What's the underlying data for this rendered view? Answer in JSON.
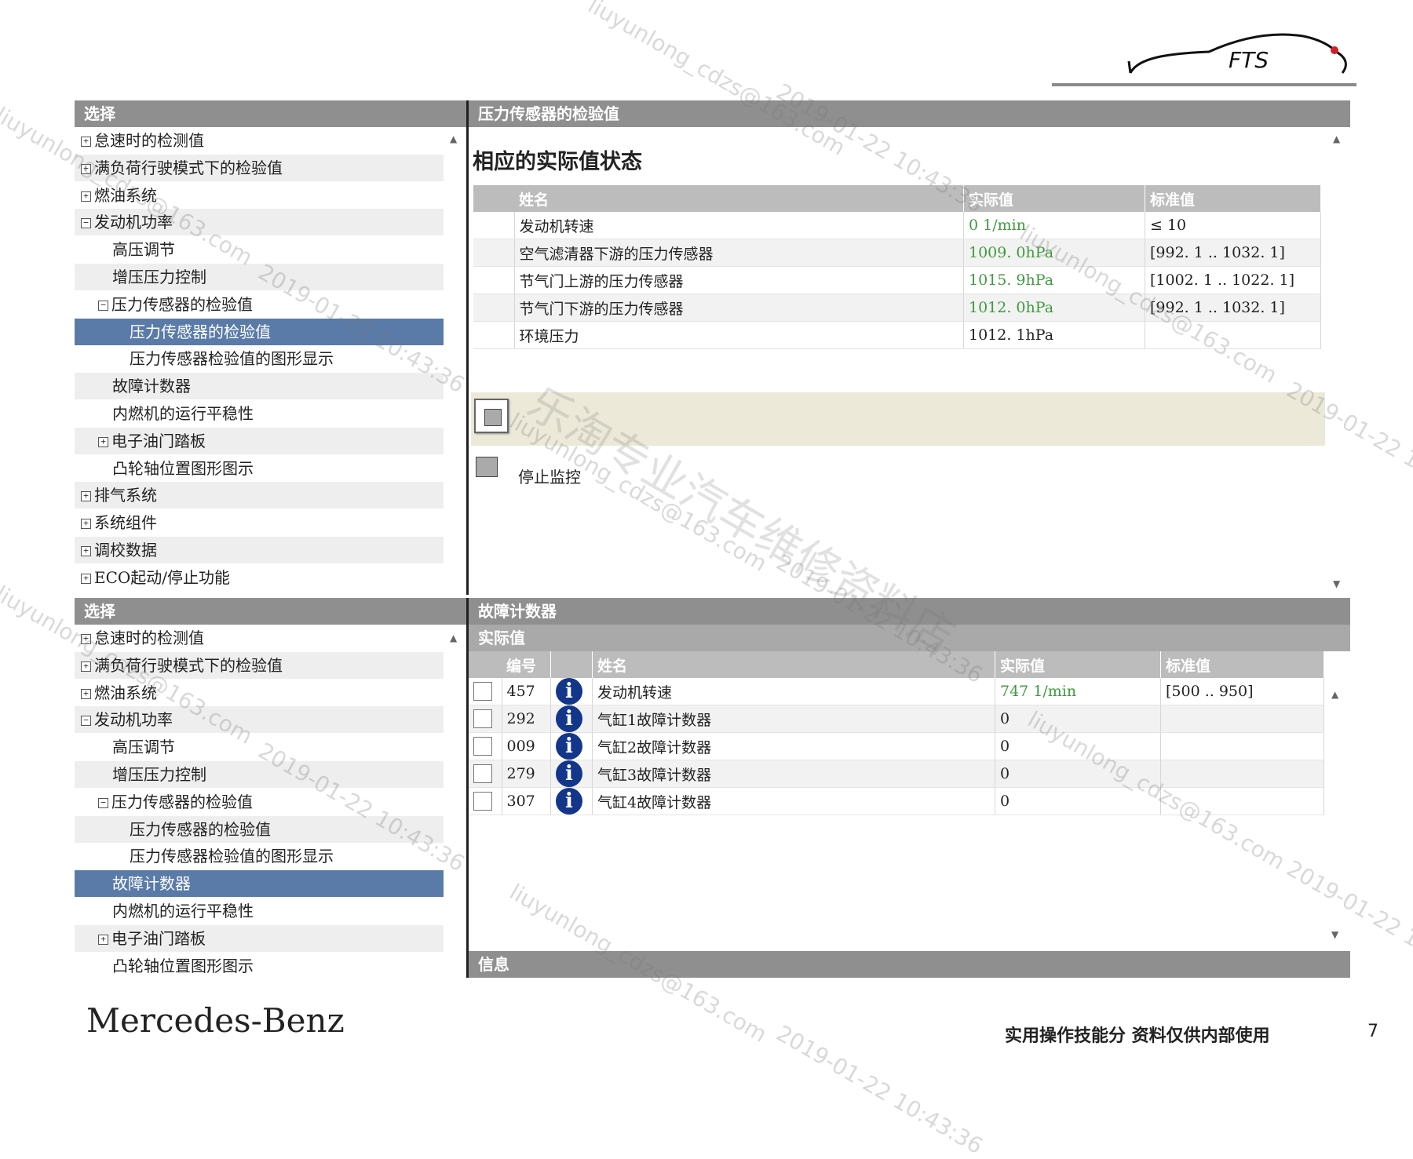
{
  "logo": {
    "text": "FTS"
  },
  "top_left": {
    "header": "选择",
    "items": [
      {
        "label": "怠速时的检测值",
        "indent": 0,
        "expander": "+"
      },
      {
        "label": "满负荷行驶模式下的检验值",
        "indent": 0,
        "expander": "+"
      },
      {
        "label": "燃油系统",
        "indent": 0,
        "expander": "+"
      },
      {
        "label": "发动机功率",
        "indent": 0,
        "expander": "-"
      },
      {
        "label": "高压调节",
        "indent": 1,
        "expander": ""
      },
      {
        "label": "增压压力控制",
        "indent": 1,
        "expander": ""
      },
      {
        "label": "压力传感器的检验值",
        "indent": 1,
        "expander": "-"
      },
      {
        "label": "压力传感器的检验值",
        "indent": 2,
        "expander": "",
        "selected": true
      },
      {
        "label": "压力传感器检验值的图形显示",
        "indent": 2,
        "expander": ""
      },
      {
        "label": "故障计数器",
        "indent": 1,
        "expander": ""
      },
      {
        "label": "内燃机的运行平稳性",
        "indent": 1,
        "expander": ""
      },
      {
        "label": "电子油门踏板",
        "indent": 1,
        "expander": "+"
      },
      {
        "label": "凸轮轴位置图形图示",
        "indent": 1,
        "expander": ""
      },
      {
        "label": "排气系统",
        "indent": 0,
        "expander": "+"
      },
      {
        "label": "系统组件",
        "indent": 0,
        "expander": "+"
      },
      {
        "label": "调校数据",
        "indent": 0,
        "expander": "+"
      },
      {
        "label": "ECO起动/停止功能",
        "indent": 0,
        "expander": "+"
      }
    ]
  },
  "top_right": {
    "header": "压力传感器的检验值",
    "section_title": "相应的实际值状态",
    "columns": [
      "姓名",
      "实际值",
      "标准值"
    ],
    "rows": [
      {
        "name": "发动机转速",
        "actual": "0 1/min",
        "standard": "≤ 10",
        "green": true
      },
      {
        "name": "空气滤清器下游的压力传感器",
        "actual": "1009. 0hPa",
        "standard": "[992. 1 .. 1032. 1]",
        "green": true
      },
      {
        "name": "节气门上游的压力传感器",
        "actual": "1015. 9hPa",
        "standard": "[1002. 1 .. 1022. 1]",
        "green": true
      },
      {
        "name": "节气门下游的压力传感器",
        "actual": "1012. 0hPa",
        "standard": "[992. 1 .. 1032. 1]",
        "green": true
      },
      {
        "name": "环境压力",
        "actual": "1012. 1hPa",
        "standard": "",
        "green": false
      }
    ],
    "stop_label": "停止监控"
  },
  "bottom_left": {
    "header": "选择",
    "items": [
      {
        "label": "怠速时的检测值",
        "indent": 0,
        "expander": "+"
      },
      {
        "label": "满负荷行驶模式下的检验值",
        "indent": 0,
        "expander": "+"
      },
      {
        "label": "燃油系统",
        "indent": 0,
        "expander": "+"
      },
      {
        "label": "发动机功率",
        "indent": 0,
        "expander": "-"
      },
      {
        "label": "高压调节",
        "indent": 1,
        "expander": ""
      },
      {
        "label": "增压压力控制",
        "indent": 1,
        "expander": ""
      },
      {
        "label": "压力传感器的检验值",
        "indent": 1,
        "expander": "-"
      },
      {
        "label": "压力传感器的检验值",
        "indent": 2,
        "expander": ""
      },
      {
        "label": "压力传感器检验值的图形显示",
        "indent": 2,
        "expander": ""
      },
      {
        "label": "故障计数器",
        "indent": 1,
        "expander": "",
        "selected": true
      },
      {
        "label": "内燃机的运行平稳性",
        "indent": 1,
        "expander": ""
      },
      {
        "label": "电子油门踏板",
        "indent": 1,
        "expander": "+"
      },
      {
        "label": "凸轮轴位置图形图示",
        "indent": 1,
        "expander": ""
      }
    ]
  },
  "bottom_right": {
    "header": "故障计数器",
    "subheader": "实际值",
    "columns": [
      "编号",
      "姓名",
      "实际值",
      "标准值"
    ],
    "rows": [
      {
        "code": "457",
        "name": "发动机转速",
        "actual": "747 1/min",
        "standard": "[500 .. 950]",
        "green": true
      },
      {
        "code": "292",
        "name": "气缸1故障计数器",
        "actual": "0",
        "standard": "",
        "green": false
      },
      {
        "code": "009",
        "name": "气缸2故障计数器",
        "actual": "0",
        "standard": "",
        "green": false
      },
      {
        "code": "279",
        "name": "气缸3故障计数器",
        "actual": "0",
        "standard": "",
        "green": false
      },
      {
        "code": "307",
        "name": "气缸4故障计数器",
        "actual": "0",
        "standard": "",
        "green": false
      }
    ],
    "info_header": "信息"
  },
  "watermarks": {
    "email": "liuyunlong_cdzs@163.com",
    "date": "2019-01-22 10:43:36",
    "shop": "乐淘专业汽车维修资料店"
  },
  "footer": {
    "brand": "Mercedes-Benz",
    "note": "实用操作技能分 资料仅供内部使用",
    "page": "7"
  },
  "colors": {
    "header_gray": "#8f8f8f",
    "selected": "#5a7ba8",
    "value_green": "#3f9b3f",
    "info_blue": "#13358a"
  }
}
